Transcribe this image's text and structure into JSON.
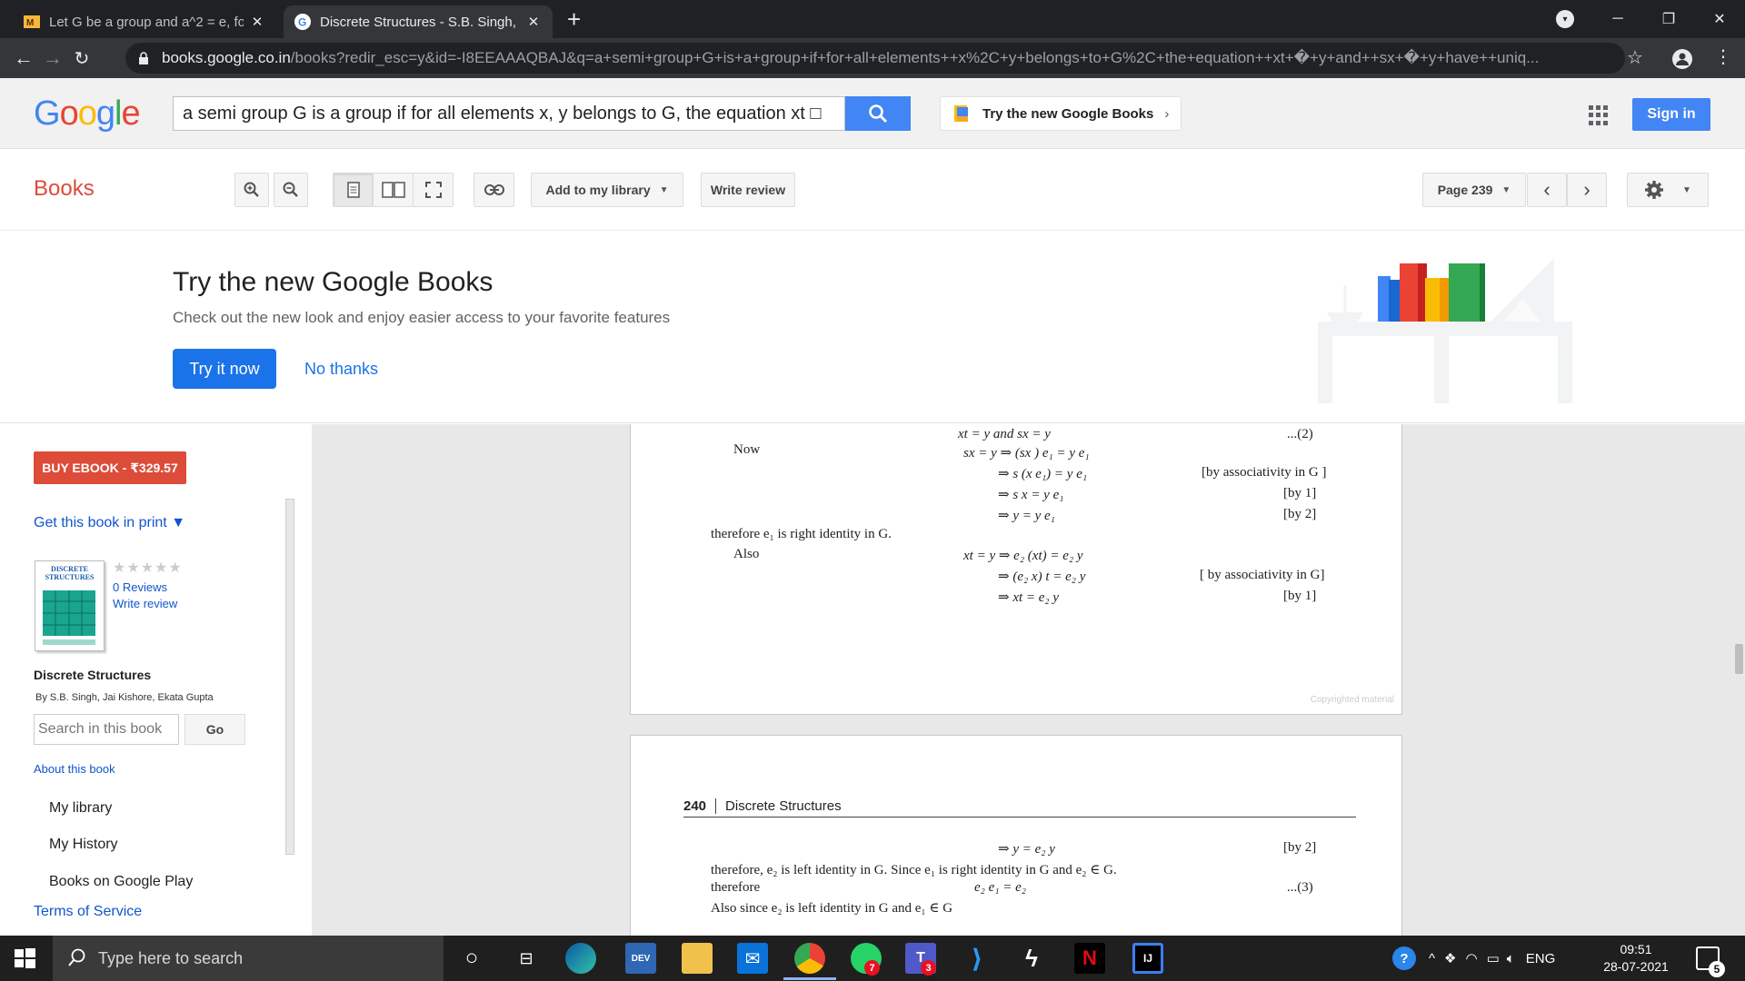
{
  "browser": {
    "tabs": [
      {
        "title": "Let G be a group and a^2 = e, fo",
        "favicon_text": "M"
      },
      {
        "title": "Discrete Structures - S.B. Singh, J",
        "favicon_text": "G"
      }
    ],
    "url_host": "books.google.co.in",
    "url_path": "/books?redir_esc=y&id=-I8EEAAAQBAJ&q=a+semi+group+G+is+a+group+if+for+all+elements++x%2C+y+belongs+to+G%2C+the+equation++xt+�+y+and++sx+�+y+have++uniq..."
  },
  "google_header": {
    "logo": "Google",
    "search_query": "a semi group G is a group if for all elements  x, y belongs to G, the equation  xt □",
    "try_new_pill": "Try the new Google Books",
    "signin": "Sign in"
  },
  "toolbar": {
    "books_label": "Books",
    "add_library": "Add to my library",
    "write_review": "Write review",
    "page_selector": "Page 239"
  },
  "promo": {
    "title": "Try the new Google Books",
    "subtitle": "Check out the new look and enjoy easier access to your favorite features",
    "try_button": "Try it now",
    "no_thanks": "No thanks"
  },
  "sidebar": {
    "buy": "BUY EBOOK - ₹329.57",
    "get_print": "Get this book in print ▼",
    "stars": "★★★★★",
    "reviews": "0 Reviews",
    "write_review": "Write review",
    "cover_text": "DISCRETE STRUCTURES",
    "book_title": "Discrete Structures",
    "authors": "By S.B. Singh, Jai Kishore, Ekata Gupta",
    "search_placeholder": "Search in this book",
    "go": "Go",
    "about": "About this book",
    "my_library": "My library",
    "my_history": "My History",
    "play": "Books on Google Play",
    "tos": "Terms of Service"
  },
  "page1": {
    "l1_math": "xt = y and sx = y",
    "l1_tag": "...(2)",
    "l2_label": "Now",
    "l2_math": "sx = y ⇒ (sx ) e₁ = y e₁",
    "l3_math": "⇒ s (x e₁) = y e₁",
    "l3_note": "[by associativity in G ]",
    "l4_math": "⇒ s x = y e₁",
    "l4_note": "[by 1]",
    "l5_math": "⇒ y = y e₁",
    "l5_note": "[by 2]",
    "l6_text": "therefore e₁ is right identity in G.",
    "l7_label": "Also",
    "l7_math": "xt = y ⇒ e₂ (xt) = e₂ y",
    "l8_math": "⇒ (e₂ x) t = e₂ y",
    "l8_note": "[ by associativity in G]",
    "l9_math": "⇒ xt = e₂ y",
    "l9_note": "[by 1]",
    "copyright": "Copyrighted material"
  },
  "page2": {
    "page_number": "240",
    "running_title": "Discrete Structures",
    "l1_math": "⇒ y = e₂ y",
    "l1_note": "[by 2]",
    "l2_text": "therefore, e₂ is left identity in G. Since e₁ is right identity in G and e₂ ∈ G.",
    "l3_label": "therefore",
    "l3_math": "e₂ e₁ = e₂",
    "l3_tag": "...(3)",
    "l4_text": "Also since e₂ is left identity in G and e₁ ∈ G"
  },
  "taskbar": {
    "search_placeholder": "Type here to search",
    "whatsapp_badge": "7",
    "teams_badge": "3",
    "lang": "ENG",
    "time": "09:51",
    "date": "28-07-2021",
    "notifications": "5"
  }
}
